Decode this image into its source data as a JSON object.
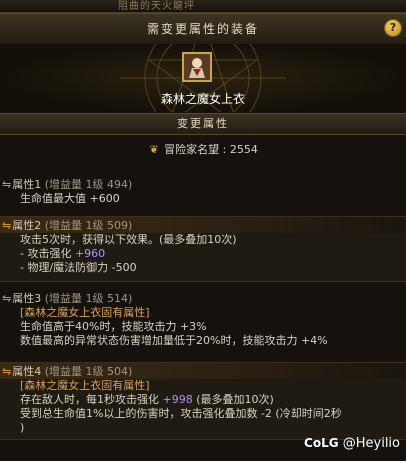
{
  "window": {
    "top_title": "阻曲的天火龍坪"
  },
  "header": {
    "title": "需变更属性的装备",
    "help": "?"
  },
  "equipment": {
    "name": "森林之魔女上衣",
    "icon": "witch-robe-icon"
  },
  "section": {
    "title": "变更属性"
  },
  "reputation": {
    "label": "冒险家名望 : 2554",
    "icon": "laurel-icon"
  },
  "attributes": [
    {
      "head": "属性1",
      "level": "(增益量 1级 494)",
      "lines": [
        {
          "text": "生命值最大值 ",
          "value": "+600"
        }
      ]
    },
    {
      "head": "属性2",
      "level": "(增益量 1级 509)",
      "lines": [
        {
          "text": "攻击5次时，获得以下效果。(最多叠加10次)"
        },
        {
          "text": "- 攻击强化 ",
          "value": "+960"
        },
        {
          "text": "- 物理/魔法防御力 -500"
        }
      ]
    },
    {
      "head": "属性3",
      "level": "(增益量 1级 514)",
      "lines": [
        {
          "text": "[森林之魔女上衣固有属性]",
          "tone": "orange"
        },
        {
          "text": "生命值高于40%时，技能攻击力 +3%"
        },
        {
          "text": "数值最高的异常状态伤害增加量低于20%时，技能攻击力 +4%"
        }
      ]
    },
    {
      "head": "属性4",
      "level": "(增益量 1级 504)",
      "lines": [
        {
          "text": "[森林之魔女上衣固有属性]",
          "tone": "orange"
        },
        {
          "text": "存在敌人时，每1秒攻击强化 ",
          "value": "+998",
          "tail": " (最多叠加10次)"
        },
        {
          "text": "受到总生命值1%以上的伤害时，攻击强化叠加数 -2 (冷却时间2秒"
        },
        {
          "text": ")"
        }
      ]
    }
  ],
  "watermark": {
    "brand": "CoLG",
    "user": "@Heyilio"
  }
}
